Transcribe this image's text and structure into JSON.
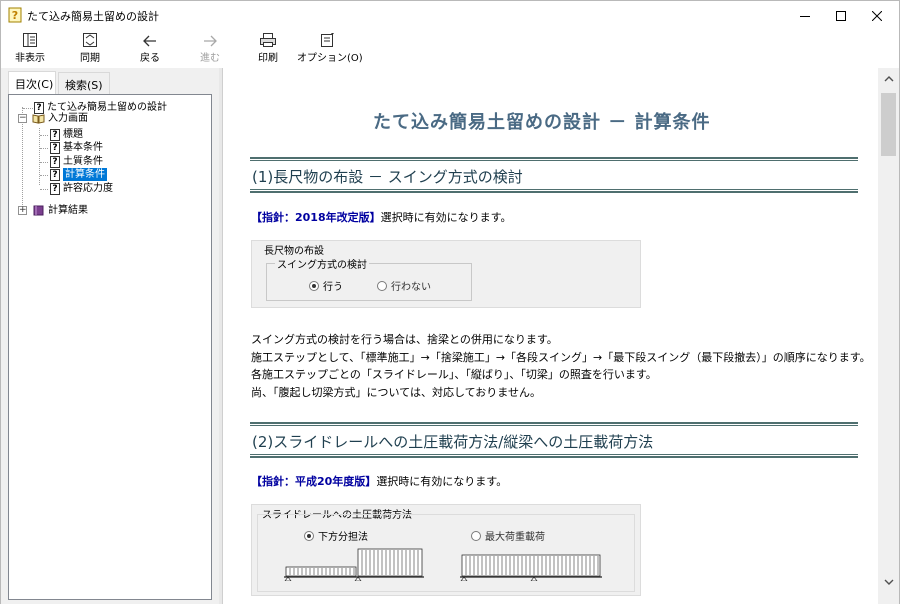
{
  "window": {
    "title": "たて込み簡易土留めの設計",
    "controls": [
      "minimize",
      "maximize",
      "close"
    ]
  },
  "toolbar": {
    "buttons": [
      {
        "label": "非表示",
        "icon": "hide-pane-icon",
        "enabled": true
      },
      {
        "label": "同期",
        "icon": "sync-icon",
        "enabled": true
      },
      {
        "label": "戻る",
        "icon": "back-arrow-icon",
        "enabled": true
      },
      {
        "label": "進む",
        "icon": "forward-arrow-icon",
        "enabled": false
      },
      {
        "label": "印刷",
        "icon": "printer-icon",
        "enabled": true
      },
      {
        "label": "オプション(O)",
        "icon": "options-icon",
        "enabled": true
      }
    ]
  },
  "sidebar": {
    "tabs": [
      {
        "label": "目次(C)",
        "active": true
      },
      {
        "label": "検索(S)",
        "active": false
      }
    ],
    "tree": [
      {
        "label": "たて込み簡易土留めの設計",
        "icon": "help-topic-icon"
      },
      {
        "label": "入力画面",
        "icon": "open-book-icon",
        "expander": "−"
      },
      {
        "label": "標題",
        "icon": "help-topic-icon"
      },
      {
        "label": "基本条件",
        "icon": "help-topic-icon"
      },
      {
        "label": "土質条件",
        "icon": "help-topic-icon"
      },
      {
        "label": "計算条件",
        "icon": "help-topic-icon",
        "selected": true
      },
      {
        "label": "許容応力度",
        "icon": "help-topic-icon"
      },
      {
        "label": "計算結果",
        "icon": "closed-book-icon",
        "expander": "+"
      }
    ]
  },
  "content": {
    "page_title": "たて込み簡易土留めの設計 － 計算条件",
    "section1": {
      "heading": "(1)長尺物の布設 － スイング方式の検討",
      "note_kw": "【指針：2018年改定版】",
      "note_rest": "選択時に有効になります。",
      "panel_legend": "長尺物の布設",
      "group_legend": "スイング方式の検討",
      "options": [
        {
          "label": "行う",
          "selected": true
        },
        {
          "label": "行わない",
          "selected": false
        }
      ],
      "paragraphs": [
        "スイング方式の検討を行う場合は、捨梁との併用になります。",
        "施工ステップとして、「標準施工」→「捨梁施工」→「各段スイング」→「最下段スイング（最下段撤去）」の順序になります。",
        "各施工ステップごとの「スライドレール」、「縦ばり」、「切梁」の照査を行います。",
        "尚、「腹起し切梁方式」については、対応しておりません。"
      ]
    },
    "section2": {
      "heading": "(2)スライドレールへの土圧載荷方法/縦梁への土圧載荷方法",
      "note_kw": "【指針：平成20年度版】",
      "note_rest": "選択時に有効になります。",
      "panel_legend": "スライドレールへの土圧載荷方法",
      "options": [
        {
          "label": "下方分担法",
          "selected": true
        },
        {
          "label": "最大荷重載荷",
          "selected": false
        }
      ]
    }
  },
  "colors": {
    "title_blue": "#4a6a84",
    "keyword_blue": "#0000a0",
    "selection": "#0078d7",
    "rule": "#4f6f6f"
  }
}
